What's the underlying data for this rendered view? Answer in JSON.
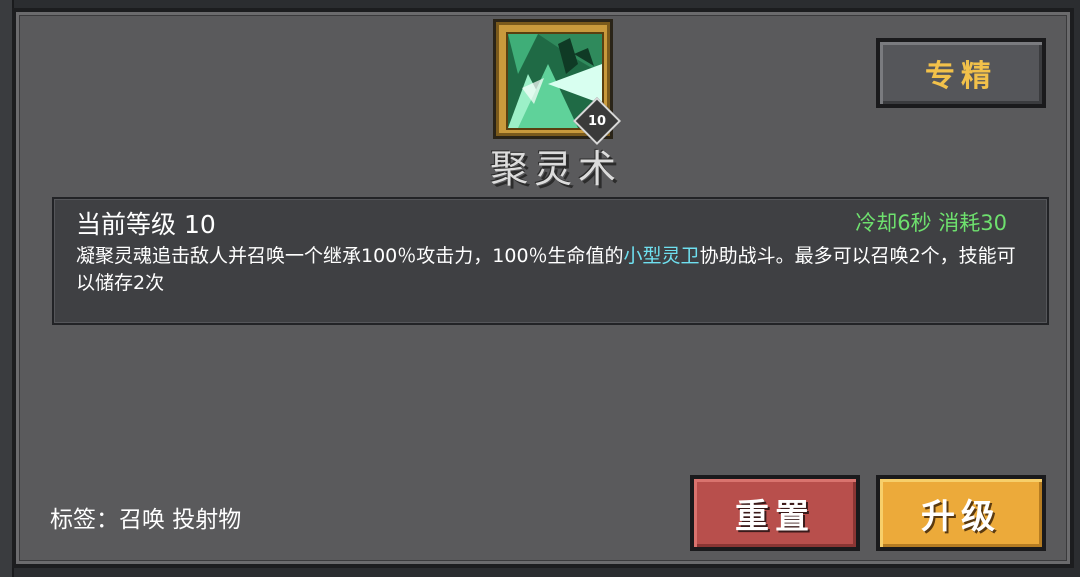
{
  "skill": {
    "name": "聚灵术",
    "level_badge": "10",
    "icon": "green-spirit-swirl-icon"
  },
  "header": {
    "spec_label": "专精"
  },
  "details": {
    "level_label": "当前等级 10",
    "stats": "冷却6秒 消耗30",
    "desc_before": "凝聚灵魂追击敌人并召唤一个继承100％攻击力，100％生命值的",
    "desc_highlight": "小型灵卫",
    "desc_after": "协助战斗。最多可以召唤2个，技能可以储存2次"
  },
  "tags": {
    "label": "标签：召唤 投射物"
  },
  "actions": {
    "reset_label": "重置",
    "upgrade_label": "升级"
  },
  "colors": {
    "stats_green": "#6ee06e",
    "highlight_cyan": "#6fe0f0",
    "spec_gold": "#f2c14a",
    "reset_red": "#b84f4c",
    "upgrade_orange": "#ecaa3a"
  }
}
